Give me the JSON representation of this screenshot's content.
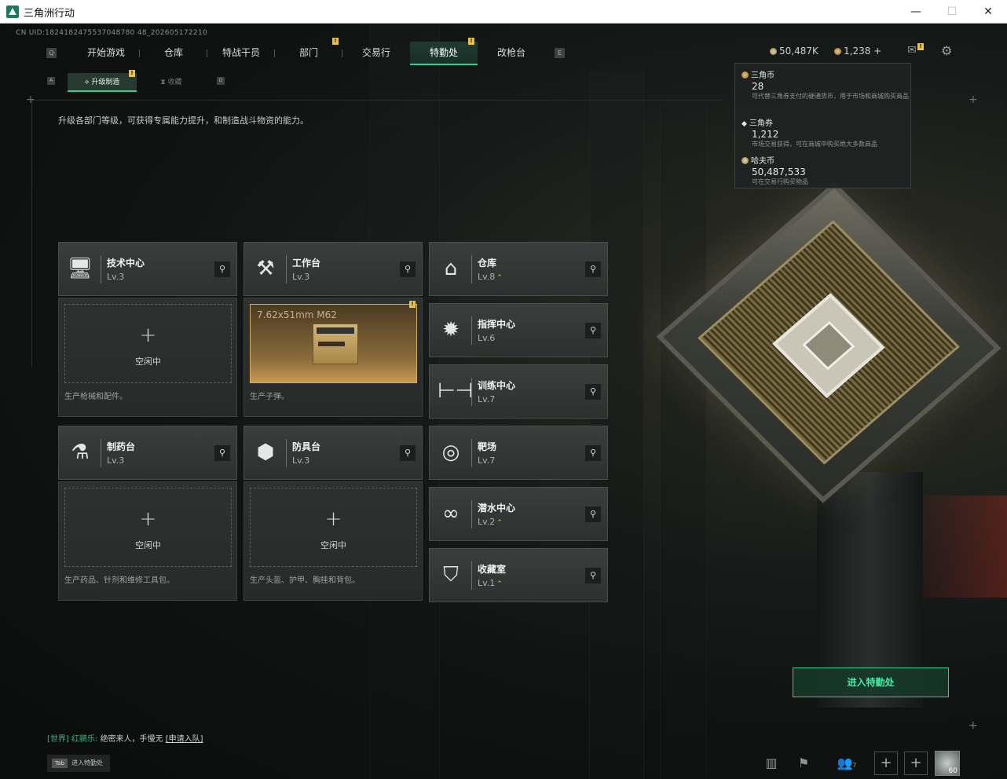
{
  "window": {
    "title": "三角洲行动",
    "minimize": "—",
    "maximize": "☐",
    "close": "✕"
  },
  "uid": "CN UID:1824182475537048780 48_202605172210",
  "nav": {
    "left_key": "Q",
    "right_key": "E",
    "tabs": [
      "开始游戏",
      "仓库",
      "特战干员",
      "部门",
      "交易行",
      "特勤处",
      "改枪台"
    ],
    "active": "特勤处",
    "badge": "!"
  },
  "subnav": {
    "left_key": "A",
    "right_key": "D",
    "tabs": [
      "升级制造",
      "收藏"
    ],
    "active": "升级制造",
    "badge": "!"
  },
  "description": "升级各部门等级，可获得专属能力提升，和制造战斗物资的能力。",
  "currency": {
    "haf": "50,487K",
    "tri": "1,238",
    "add": "+"
  },
  "tooltip": {
    "items": [
      {
        "name": "三角币",
        "value": "28",
        "desc": "可代替三角券支付的硬通货币，用于市场和商城购买商品"
      },
      {
        "name": "三角券",
        "value": "1,212",
        "desc": "市场交易获得，可在商城中购买绝大多数商品"
      },
      {
        "name": "哈夫币",
        "value": "50,487,533",
        "desc": "可在交易行购买物品"
      }
    ]
  },
  "departments": [
    {
      "id": "tech",
      "name": "技术中心",
      "level": "Lv.3",
      "icon": "monitor-icon",
      "glyph": "🖥",
      "upgrade": false
    },
    {
      "id": "workbench",
      "name": "工作台",
      "level": "Lv.3",
      "icon": "tools-icon",
      "glyph": "⚒",
      "upgrade": false
    },
    {
      "id": "pharma",
      "name": "制药台",
      "level": "Lv.3",
      "icon": "microscope-icon",
      "glyph": "⚗",
      "upgrade": false
    },
    {
      "id": "armor",
      "name": "防具台",
      "level": "Lv.3",
      "icon": "boxes-icon",
      "glyph": "⬢",
      "upgrade": false
    },
    {
      "id": "warehouse",
      "name": "仓库",
      "level": "Lv.8",
      "icon": "warehouse-icon",
      "glyph": "⌂",
      "upgrade": true
    },
    {
      "id": "command",
      "name": "指挥中心",
      "level": "Lv.6",
      "icon": "command-icon",
      "glyph": "✹",
      "upgrade": false
    },
    {
      "id": "training",
      "name": "训练中心",
      "level": "Lv.7",
      "icon": "dumbbell-icon",
      "glyph": "⊢⊣",
      "upgrade": false
    },
    {
      "id": "range",
      "name": "靶场",
      "level": "Lv.7",
      "icon": "target-icon",
      "glyph": "◎",
      "upgrade": false
    },
    {
      "id": "diving",
      "name": "潜水中心",
      "level": "Lv.2",
      "icon": "diving-goggles-icon",
      "glyph": "∞",
      "upgrade": true
    },
    {
      "id": "collection",
      "name": "收藏室",
      "level": "Lv.1",
      "icon": "collection-icon",
      "glyph": "⛉",
      "upgrade": true
    }
  ],
  "upgrade_glyph": "⌃",
  "slots": {
    "tech": {
      "state": "空闲中",
      "plus": "+",
      "desc": "生产枪械和配件。"
    },
    "workbench": {
      "product": "7.62x51mm M62",
      "badge": "!",
      "desc": "生产子弹。"
    },
    "pharma": {
      "state": "空闲中",
      "plus": "+",
      "desc": "生产药品、针剂和维修工具包。"
    },
    "armor": {
      "state": "空闲中",
      "plus": "+",
      "desc": "生产头盔、护甲、胸挂和背包。"
    }
  },
  "enter_button": "进入特勤处",
  "chat": {
    "channel": "[世界]",
    "user": "红鹂乐:",
    "message": "绝密来人，手慢无",
    "link": "[申请入队]"
  },
  "tab_hint": {
    "key": "Tab",
    "label": "进入特勤处"
  },
  "bottom": {
    "friends_count": "7",
    "avatar_level": "60"
  },
  "colors": {
    "accent": "#2fd08f",
    "gold": "#e8c14a"
  }
}
